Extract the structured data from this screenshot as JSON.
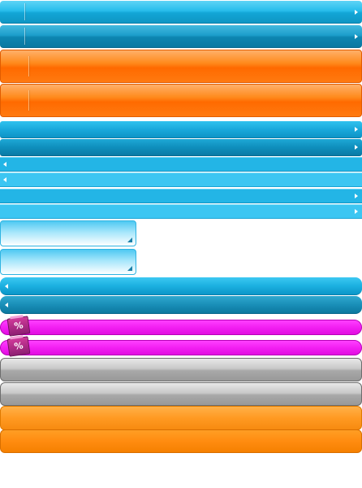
{
  "colors": {
    "blue": "#12a6d6",
    "orange": "#ff6a00",
    "magenta": "#f21ff2",
    "gray": "#aaaaaa",
    "amber": "#ff9a22"
  },
  "icons": {
    "right": "arrow-right-icon",
    "left": "arrow-left-icon",
    "discount": "discount-tag-icon",
    "resize": "resize-grip-icon"
  },
  "tags": {
    "discount_1": "%",
    "discount_2": "%"
  }
}
